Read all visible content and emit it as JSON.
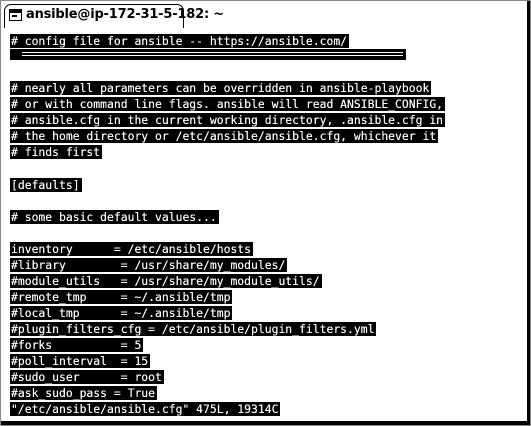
{
  "window": {
    "tab_title": "ansible@ip-172-31-5-182: ~"
  },
  "terminal": {
    "lines": [
      "# config file for ansible -- https://ansible.com/",
      "# ===============================================",
      "",
      "# nearly all parameters can be overridden in ansible-playbook",
      "# or with command line flags. ansible will read ANSIBLE_CONFIG,",
      "# ansible.cfg in the current working directory, .ansible.cfg in",
      "# the home directory or /etc/ansible/ansible.cfg, whichever it",
      "# finds first",
      "",
      "[defaults]",
      "",
      "# some basic default values...",
      "",
      "inventory      = /etc/ansible/hosts",
      "#library        = /usr/share/my_modules/",
      "#module_utils   = /usr/share/my_module_utils/",
      "#remote_tmp     = ~/.ansible/tmp",
      "#local_tmp      = ~/.ansible/tmp",
      "#plugin_filters_cfg = /etc/ansible/plugin_filters.yml",
      "#forks          = 5",
      "#poll_interval  = 15",
      "#sudo_user      = root",
      "#ask_sudo_pass = True"
    ],
    "status_line": "\"/etc/ansible/ansible.cfg\" 475L, 19314C"
  }
}
